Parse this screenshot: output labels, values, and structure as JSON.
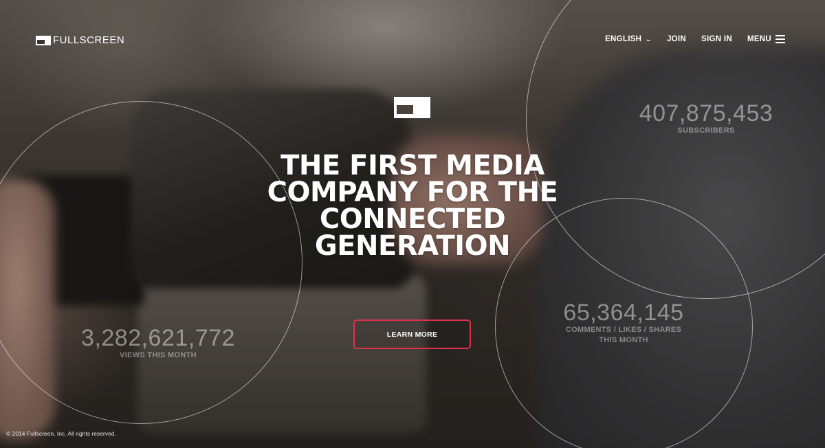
{
  "brand": {
    "logo_text": "FULLSCREEN"
  },
  "nav": {
    "language_label": "ENGLISH",
    "join_label": "JOIN",
    "signin_label": "SIGN IN",
    "menu_label": "MENU"
  },
  "hero": {
    "headline_lines": [
      "THE FIRST MEDIA",
      "COMPANY FOR THE",
      "CONNECTED",
      "GENERATION"
    ],
    "cta_label": "LEARN MORE"
  },
  "stats": {
    "subscribers": {
      "value": "407,875,453",
      "label_lines": [
        "SUBSCRIBERS"
      ]
    },
    "engagement": {
      "value": "65,364,145",
      "label_lines": [
        "COMMENTS / LIKES / SHARES",
        "THIS MONTH"
      ]
    },
    "views": {
      "value": "3,282,621,772",
      "label_lines": [
        "VIEWS THIS MONTH"
      ]
    }
  },
  "footer": {
    "copyright": "© 2014 Fullscreen, Inc. All rights reserved."
  },
  "colors": {
    "accent": "#e0314b",
    "text": "#ffffff"
  },
  "icons": {
    "logo": "fullscreen-logo-icon",
    "language_caret": "chevron-down-icon",
    "menu": "hamburger-icon",
    "hero_mark": "fullscreen-mark-icon"
  }
}
